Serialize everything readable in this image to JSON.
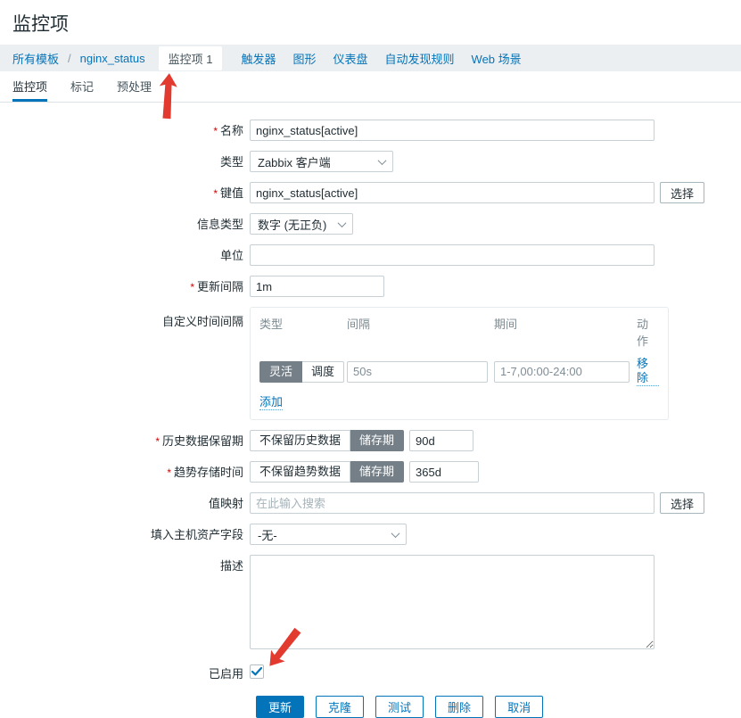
{
  "page": {
    "title": "监控项"
  },
  "required_marker": "*",
  "breadcrumb": {
    "all_templates": "所有模板",
    "separator": "/",
    "template": "nginx_status"
  },
  "nav": {
    "items": [
      {
        "label": "监控项 1",
        "selected": true
      },
      {
        "label": "触发器"
      },
      {
        "label": "图形"
      },
      {
        "label": "仪表盘"
      },
      {
        "label": "自动发现规则"
      },
      {
        "label": "Web 场景"
      }
    ]
  },
  "tabs": {
    "items": [
      {
        "label": "监控项",
        "active": true
      },
      {
        "label": "标记"
      },
      {
        "label": "预处理"
      }
    ]
  },
  "form": {
    "name": {
      "label": "名称",
      "required": true,
      "value": "nginx_status[active]"
    },
    "type": {
      "label": "类型",
      "value": "Zabbix 客户端"
    },
    "key": {
      "label": "键值",
      "required": true,
      "value": "nginx_status[active]",
      "select_button": "选择"
    },
    "info_type": {
      "label": "信息类型",
      "value": "数字 (无正负)"
    },
    "units": {
      "label": "单位",
      "value": ""
    },
    "update_interval": {
      "label": "更新间隔",
      "required": true,
      "value": "1m"
    },
    "custom_intervals": {
      "label": "自定义时间间隔",
      "headers": {
        "type": "类型",
        "interval": "间隔",
        "period": "期间",
        "action": "动作"
      },
      "row": {
        "flexible_label": "灵活",
        "scheduling_label": "调度",
        "active_option": "灵活",
        "interval": "50s",
        "period": "1-7,00:00-24:00",
        "remove_label": "移除"
      },
      "add_label": "添加"
    },
    "history": {
      "label": "历史数据保留期",
      "required": true,
      "off_label": "不保留历史数据",
      "on_label": "储存期",
      "active_option": "储存期",
      "value": "90d"
    },
    "trends": {
      "label": "趋势存储时间",
      "required": true,
      "off_label": "不保留趋势数据",
      "on_label": "储存期",
      "active_option": "储存期",
      "value": "365d"
    },
    "value_map": {
      "label": "值映射",
      "value": "",
      "placeholder": "在此输入搜索",
      "select_button": "选择"
    },
    "inventory": {
      "label": "填入主机资产字段",
      "value": "-无-"
    },
    "description": {
      "label": "描述",
      "value": ""
    },
    "enabled": {
      "label": "已启用",
      "checked": true
    }
  },
  "footer_buttons": {
    "update": "更新",
    "clone": "克隆",
    "test": "测试",
    "delete": "删除",
    "cancel": "取消"
  },
  "colors": {
    "accent": "#0474ba",
    "segment_active": "#747f88",
    "arrow_red": "#e23a2e",
    "navband_bg": "#eceff1"
  }
}
